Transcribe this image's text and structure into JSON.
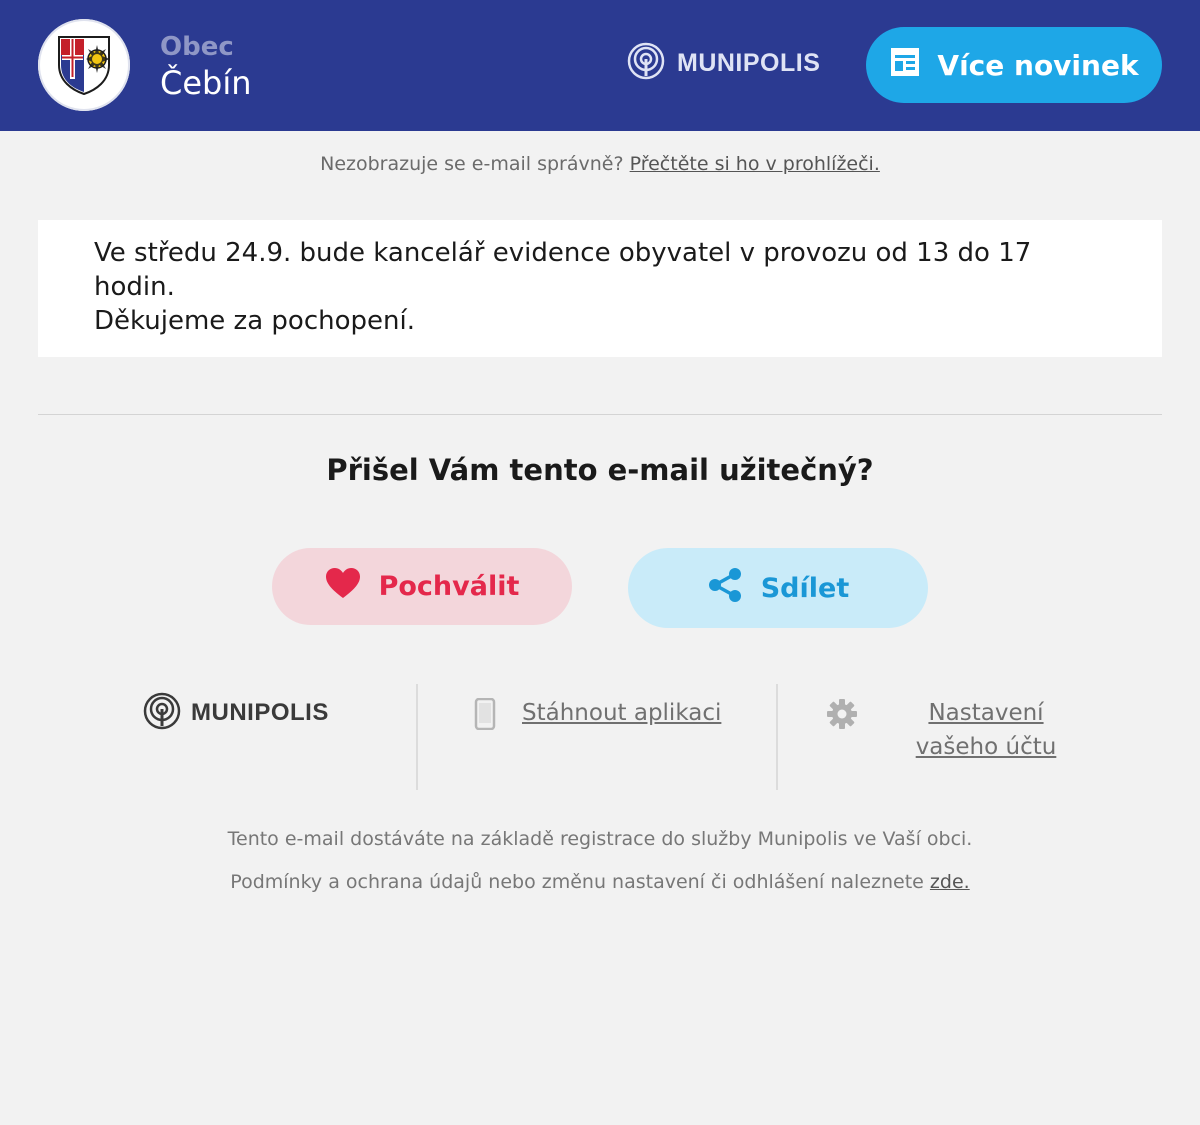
{
  "header": {
    "town_kind": "Obec",
    "town_name": "Čebín",
    "brand": "MUNIPOLIS",
    "more_news_label": "Více novinek",
    "crest_icon": "municipal-crest-icon",
    "more_news_icon": "newspaper-icon",
    "brand_icon": "broadcast-icon",
    "colors": {
      "header_bg": "#2b3a91",
      "button_bg": "#1ea7e7"
    }
  },
  "view_in_browser": {
    "prefix": "Nezobrazuje se e-mail správně?",
    "link_label": "Přečtěte si ho v prohlížeči."
  },
  "message": {
    "line1": "Ve středu 24.9. bude kancelář evidence obyvatel v provozu od 13 do 17 hodin.",
    "line2": "Děkujeme za pochopení."
  },
  "feedback": {
    "question": "Přišel Vám tento e-mail užitečný?",
    "praise_label": "Pochválit",
    "praise_icon": "heart-icon",
    "share_label": "Sdílet",
    "share_icon": "share-icon",
    "colors": {
      "praise_bg": "#f3d6db",
      "praise_text": "#e4284b",
      "share_bg": "#c9ebf9",
      "share_text": "#1a97d6"
    }
  },
  "footer": {
    "brand": "MUNIPOLIS",
    "app_label": "Stáhnout aplikaci",
    "app_icon": "phone-icon",
    "settings_label": "Nastavení vašeho účtu",
    "settings_icon": "gear-icon",
    "legal_line1": "Tento e-mail dostáváte na základě registrace do služby Munipolis ve Vaší obci.",
    "legal_line2_prefix": "Podmínky a ochrana údajů nebo změnu nastavení či odhlášení naleznete",
    "legal_line2_link": "zde."
  }
}
